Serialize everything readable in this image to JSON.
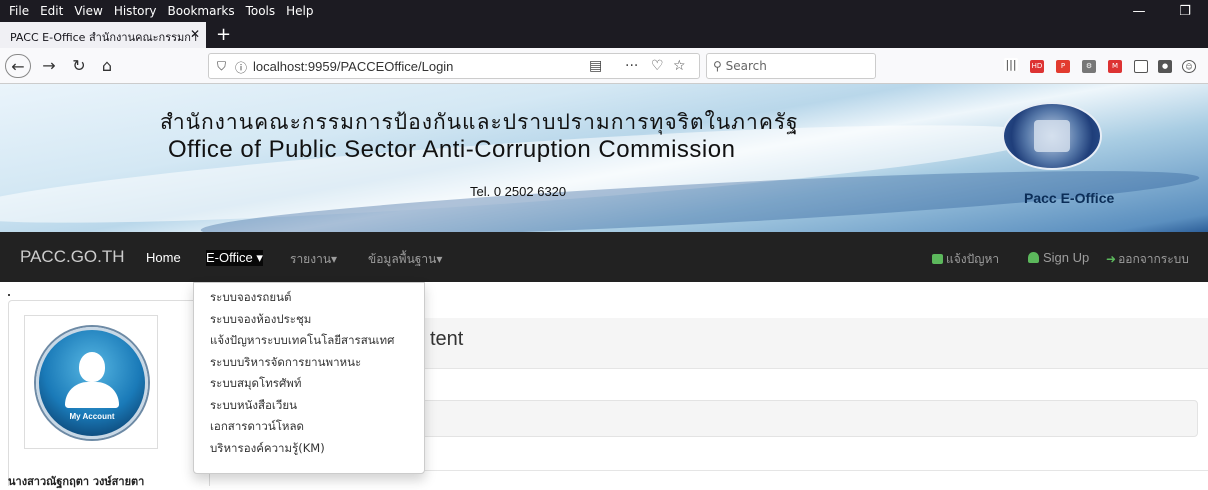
{
  "browser": {
    "menu": [
      "File",
      "Edit",
      "View",
      "History",
      "Bookmarks",
      "Tools",
      "Help"
    ],
    "tab_title": "PACC E-Office สำนักงานคณะกรรมกา",
    "url": "localhost:9959/PACCEOffice/Login",
    "search_placeholder": "Search"
  },
  "banner": {
    "title_th": "สำนักงานคณะกรรมการป้องกันและปราบปรามการทุจริตในภาครัฐ",
    "title_en": "Office of Public Sector  Anti-Corruption Commission",
    "tel": "Tel. 0 2502 6320",
    "app_name": "Pacc E-Office"
  },
  "site_nav": {
    "brand": "PACC.GO.TH",
    "home": "Home",
    "eoffice": "E-Office ▾",
    "reports": "รายงาน▾",
    "basedata": "ข้อมูลพื้นฐาน▾",
    "report_issue": "แจ้งปัญหา",
    "sign_up": "Sign Up",
    "logout": "ออกจากระบบ"
  },
  "dropdown": {
    "items": [
      "ระบบจองรถยนต์",
      "ระบบจองห้องประชุม",
      "แจ้งปัญหาระบบเทคโนโลยีสารสนเทศ",
      "ระบบบริหารจัดการยานพาหนะ",
      "ระบบสมุดโทรศัพท์",
      "ระบบหนังสือเวียน",
      "เอกสารดาวน์โหลด",
      "บริหารองค์ความรู้(KM)"
    ]
  },
  "sidebar": {
    "avatar_label": "My Account",
    "user_name": "นางสาวณัฐกฤตา วงษ์สายตา"
  },
  "main": {
    "heading_fragment": "tent"
  },
  "colors": {
    "navbar_bg": "#222222",
    "accent_green": "#5cb85c",
    "browser_chrome": "#1c1b22"
  }
}
